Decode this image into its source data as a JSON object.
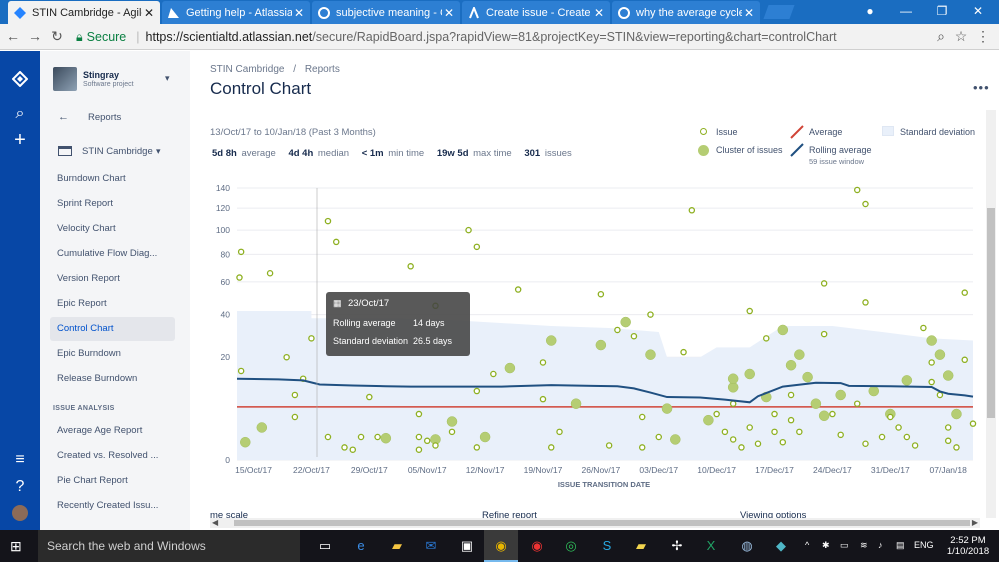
{
  "browser": {
    "tabs": [
      {
        "title": "STIN Cambridge - Agile B",
        "active": true,
        "icon": "jira-diamond-icon"
      },
      {
        "title": "Getting help - Atlassian D",
        "active": false,
        "icon": "atlassian-triangle-icon"
      },
      {
        "title": "subjective meaning - Goo",
        "active": false,
        "icon": "google-g-icon"
      },
      {
        "title": "Create issue - Create and",
        "active": false,
        "icon": "atlassian-icon"
      },
      {
        "title": "why the average cycle tim",
        "active": false,
        "icon": "google-g-icon"
      }
    ],
    "secure_label": "Secure",
    "url_host": "https://scientialtd.atlassian.net",
    "url_rest": "/secure/RapidBoard.jspa?rapidView=81&projectKey=STIN&view=reporting&chart=controlChart"
  },
  "project": {
    "name": "Stingray",
    "type": "Software project"
  },
  "sidebar": {
    "back_label": "Reports",
    "board_label": "STIN Cambridge",
    "items": [
      {
        "label": "Burndown Chart",
        "active": false
      },
      {
        "label": "Sprint Report",
        "active": false
      },
      {
        "label": "Velocity Chart",
        "active": false
      },
      {
        "label": "Cumulative Flow Diag...",
        "active": false
      },
      {
        "label": "Version Report",
        "active": false
      },
      {
        "label": "Epic Report",
        "active": false
      },
      {
        "label": "Control Chart",
        "active": true
      },
      {
        "label": "Epic Burndown",
        "active": false
      },
      {
        "label": "Release Burndown",
        "active": false
      }
    ],
    "section_title": "ISSUE ANALYSIS",
    "analysis_items": [
      {
        "label": "Average Age Report"
      },
      {
        "label": "Created vs. Resolved ..."
      },
      {
        "label": "Pie Chart Report"
      },
      {
        "label": "Recently Created Issu..."
      }
    ]
  },
  "breadcrumb": [
    "STIN Cambridge",
    "/",
    "Reports"
  ],
  "page_title": "Control Chart",
  "date_range": "13/Oct/17 to 10/Jan/18 (Past 3 Months)",
  "stats": [
    {
      "value": "5d 8h",
      "label": "average"
    },
    {
      "value": "4d 4h",
      "label": "median"
    },
    {
      "value": "< 1m",
      "label": "min time"
    },
    {
      "value": "19w 5d",
      "label": "max time"
    },
    {
      "value": "301",
      "label": "issues"
    }
  ],
  "legend": {
    "issue": "Issue",
    "cluster": "Cluster of issues",
    "average": "Average",
    "rolling": "Rolling average",
    "rolling_sub": "59 issue window",
    "stddev": "Standard deviation"
  },
  "tooltip": {
    "date": "23/Oct/17",
    "rows": [
      {
        "label": "Rolling average",
        "value": "14 days"
      },
      {
        "label": "Standard deviation",
        "value": "26.5 days"
      }
    ]
  },
  "cutoff_labels": [
    "me scale",
    "Refine report",
    "Viewing options"
  ],
  "taskbar": {
    "search_placeholder": "Search the web and Windows",
    "lang": "ENG",
    "time": "2:52 PM",
    "date": "1/10/2018"
  },
  "colors": {
    "average_line": "#d04437",
    "rolling_line": "#205081",
    "issue_dot": "#8eb021",
    "stddev_band": "#e9f0fa",
    "nav_blue": "#0747a6"
  },
  "chart_data": {
    "type": "scatter",
    "xlabel": "ISSUE TRANSITION DATE",
    "x_ticks": [
      "15/Oct/17",
      "22/Oct/17",
      "29/Oct/17",
      "05/Nov/17",
      "12/Nov/17",
      "19/Nov/17",
      "26/Nov/17",
      "03/Dec/17",
      "10/Dec/17",
      "17/Dec/17",
      "24/Dec/17",
      "31/Dec/17",
      "07/Jan/18"
    ],
    "y_ticks": [
      0,
      20,
      40,
      60,
      80,
      100,
      120,
      140
    ],
    "y_scale": "sqrt",
    "ylim": [
      0,
      140
    ],
    "xlim_days": [
      0,
      89
    ],
    "average_days": 5.33,
    "rolling_average": [
      [
        0,
        12.5
      ],
      [
        5,
        12.3
      ],
      [
        8,
        12
      ],
      [
        10,
        10.8
      ],
      [
        14,
        10.5
      ],
      [
        18,
        10.3
      ],
      [
        21,
        10.2
      ],
      [
        26,
        10.2
      ],
      [
        32,
        10.2
      ],
      [
        38,
        10.6
      ],
      [
        43,
        10.4
      ],
      [
        46,
        10.3
      ],
      [
        48,
        9.7
      ],
      [
        50,
        8.6
      ],
      [
        52,
        7.5
      ],
      [
        56,
        7.4
      ],
      [
        59,
        6.9
      ],
      [
        62,
        6.3
      ],
      [
        63,
        7.7
      ],
      [
        66,
        10.2
      ],
      [
        70,
        11.3
      ],
      [
        73,
        11.2
      ],
      [
        74,
        10.4
      ],
      [
        79,
        10.3
      ],
      [
        84,
        10.1
      ],
      [
        85,
        8.9
      ],
      [
        86,
        8.3
      ],
      [
        88,
        7.9
      ],
      [
        89,
        7.6
      ]
    ],
    "stddev_upper": [
      [
        0,
        42
      ],
      [
        3,
        42
      ],
      [
        9,
        42
      ],
      [
        9,
        38
      ],
      [
        18,
        38
      ],
      [
        26,
        37
      ],
      [
        38,
        34
      ],
      [
        45,
        33
      ],
      [
        51,
        31
      ],
      [
        52,
        20
      ],
      [
        56,
        20
      ],
      [
        58,
        24
      ],
      [
        62,
        24
      ],
      [
        66,
        34
      ],
      [
        72,
        34
      ],
      [
        78,
        31
      ],
      [
        84,
        28
      ],
      [
        89,
        27
      ]
    ],
    "issues": [
      [
        0.5,
        82
      ],
      [
        0.3,
        63
      ],
      [
        0.5,
        15
      ],
      [
        4,
        66
      ],
      [
        6,
        20
      ],
      [
        7,
        8
      ],
      [
        7,
        3.5
      ],
      [
        9,
        28
      ],
      [
        8,
        12.5
      ],
      [
        11,
        108
      ],
      [
        12,
        90
      ],
      [
        11,
        1
      ],
      [
        13,
        0.3
      ],
      [
        14,
        0.2
      ],
      [
        15,
        1
      ],
      [
        16,
        7.5
      ],
      [
        17,
        1
      ],
      [
        21,
        71
      ],
      [
        24,
        45
      ],
      [
        22,
        4
      ],
      [
        22,
        1
      ],
      [
        22,
        0.2
      ],
      [
        23,
        0.7
      ],
      [
        28,
        100
      ],
      [
        29,
        86
      ],
      [
        29,
        9
      ],
      [
        29,
        0.3
      ],
      [
        26,
        1.5
      ],
      [
        24,
        0.4
      ],
      [
        31,
        14
      ],
      [
        34,
        55
      ],
      [
        38,
        0.3
      ],
      [
        37,
        18
      ],
      [
        37,
        7
      ],
      [
        39,
        1.5
      ],
      [
        44,
        52
      ],
      [
        46,
        32
      ],
      [
        45,
        0.4
      ],
      [
        48,
        29
      ],
      [
        50,
        40
      ],
      [
        49,
        3.5
      ],
      [
        49,
        0.3
      ],
      [
        51,
        1
      ],
      [
        54,
        22
      ],
      [
        55,
        118
      ],
      [
        58,
        4
      ],
      [
        59,
        1.5
      ],
      [
        60,
        6
      ],
      [
        60,
        0.8
      ],
      [
        61,
        0.3
      ],
      [
        62,
        42
      ],
      [
        62,
        2
      ],
      [
        63,
        0.5
      ],
      [
        64,
        28
      ],
      [
        65,
        4
      ],
      [
        65,
        1.5
      ],
      [
        66,
        0.6
      ],
      [
        67,
        8
      ],
      [
        67,
        3
      ],
      [
        68,
        1.5
      ],
      [
        71,
        59
      ],
      [
        71,
        30
      ],
      [
        72,
        4
      ],
      [
        73,
        1.2
      ],
      [
        75,
        138
      ],
      [
        76,
        124
      ],
      [
        76,
        47
      ],
      [
        75,
        6
      ],
      [
        76,
        0.5
      ],
      [
        78,
        1
      ],
      [
        79,
        3.5
      ],
      [
        80,
        2
      ],
      [
        81,
        1
      ],
      [
        82,
        0.4
      ],
      [
        83,
        33
      ],
      [
        84,
        18
      ],
      [
        84,
        11.5
      ],
      [
        85,
        8
      ],
      [
        86,
        2
      ],
      [
        86,
        0.7
      ],
      [
        87,
        0.3
      ],
      [
        88,
        53
      ],
      [
        88,
        19
      ],
      [
        89,
        2.5
      ]
    ],
    "clusters": [
      [
        1,
        0.6
      ],
      [
        3,
        2
      ],
      [
        18,
        0.9
      ],
      [
        24,
        0.8
      ],
      [
        26,
        2.8
      ],
      [
        30,
        1
      ],
      [
        33,
        16
      ],
      [
        38,
        27
      ],
      [
        41,
        6
      ],
      [
        44,
        25
      ],
      [
        47,
        36
      ],
      [
        50,
        21
      ],
      [
        52,
        5
      ],
      [
        53,
        0.8
      ],
      [
        57,
        3
      ],
      [
        60,
        10
      ],
      [
        60,
        12.5
      ],
      [
        62,
        14
      ],
      [
        64,
        7.5
      ],
      [
        66,
        32
      ],
      [
        67,
        17
      ],
      [
        68,
        21
      ],
      [
        69,
        13
      ],
      [
        70,
        6
      ],
      [
        71,
        3.7
      ],
      [
        73,
        8
      ],
      [
        77,
        9
      ],
      [
        79,
        4
      ],
      [
        81,
        12
      ],
      [
        84,
        27
      ],
      [
        85,
        21
      ],
      [
        86,
        13.5
      ],
      [
        87,
        4
      ]
    ]
  }
}
